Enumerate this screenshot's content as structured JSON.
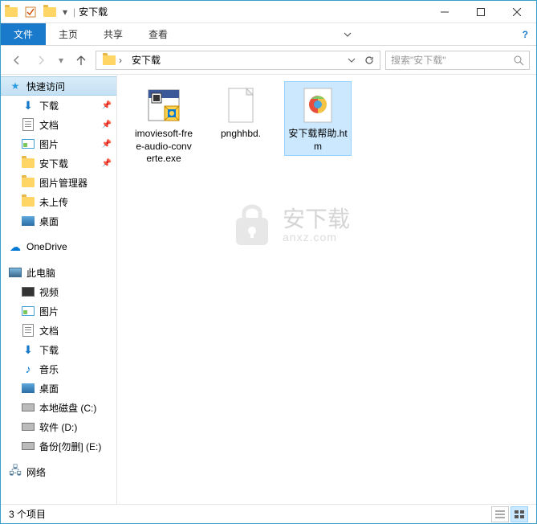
{
  "title": "安下载",
  "ribbon": {
    "file": "文件",
    "tabs": [
      "主页",
      "共享",
      "查看"
    ]
  },
  "breadcrumb": {
    "current": "安下载"
  },
  "search": {
    "placeholder": "搜索\"安下载\""
  },
  "sidebar": {
    "quick_access": "快速访问",
    "quick_items": [
      {
        "label": "下载",
        "icon": "download",
        "pinned": true
      },
      {
        "label": "文档",
        "icon": "document",
        "pinned": true
      },
      {
        "label": "图片",
        "icon": "picture",
        "pinned": true
      },
      {
        "label": "安下载",
        "icon": "folder",
        "pinned": true
      },
      {
        "label": "图片管理器",
        "icon": "folder",
        "pinned": false
      },
      {
        "label": "未上传",
        "icon": "folder",
        "pinned": false
      },
      {
        "label": "桌面",
        "icon": "desktop",
        "pinned": false
      }
    ],
    "onedrive": "OneDrive",
    "this_pc": "此电脑",
    "pc_items": [
      {
        "label": "视频",
        "icon": "video"
      },
      {
        "label": "图片",
        "icon": "picture"
      },
      {
        "label": "文档",
        "icon": "document"
      },
      {
        "label": "下载",
        "icon": "download"
      },
      {
        "label": "音乐",
        "icon": "music"
      },
      {
        "label": "桌面",
        "icon": "desktop"
      },
      {
        "label": "本地磁盘 (C:)",
        "icon": "disk"
      },
      {
        "label": "软件 (D:)",
        "icon": "disk"
      },
      {
        "label": "备份[勿删] (E:)",
        "icon": "disk"
      }
    ],
    "network": "网络"
  },
  "files": [
    {
      "name": "imoviesoft-free-audio-converte.exe",
      "type": "exe",
      "selected": false
    },
    {
      "name": "pnghhbd.",
      "type": "blank",
      "selected": false
    },
    {
      "name": "安下载帮助.htm",
      "type": "htm",
      "selected": true
    }
  ],
  "watermark": {
    "main": "安下载",
    "sub": "anxz.com"
  },
  "status": {
    "count": "3 个项目"
  }
}
